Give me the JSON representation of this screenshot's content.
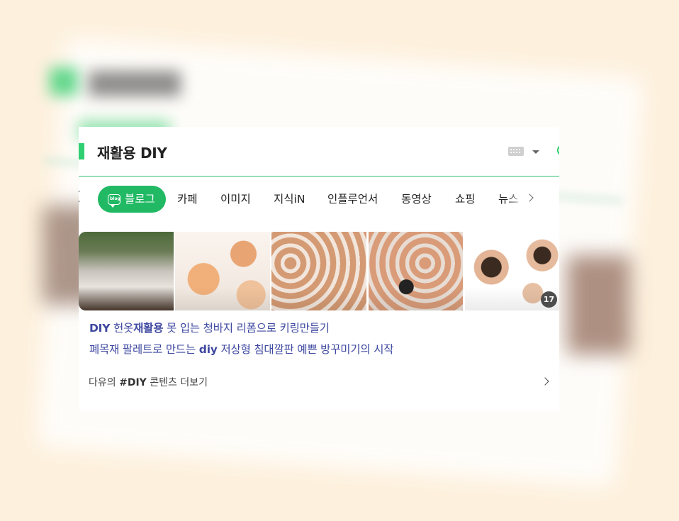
{
  "search": {
    "query": "재활용 DIY"
  },
  "tabs": [
    {
      "label": "블로그",
      "active": true,
      "icon": "blog-icon"
    },
    {
      "label": "카페"
    },
    {
      "label": "이미지"
    },
    {
      "label": "지식iN"
    },
    {
      "label": "인플루언서"
    },
    {
      "label": "동영상"
    },
    {
      "label": "쇼핑"
    },
    {
      "label": "뉴스"
    }
  ],
  "thumbnails": {
    "count_badge": "17",
    "items": [
      "egg-carton-seedlings",
      "cracked-egg-shells",
      "egg-carton-seed-packets",
      "egg-carton-soil",
      "eggshell-pots"
    ]
  },
  "links": [
    {
      "pre": "DIY",
      "mid1": " 헌옷",
      "bold2": "재활용",
      "rest": " 못 입는 청바지 리폼으로 키링만들기"
    },
    {
      "pre": "폐목재 팔레트로 만드는 ",
      "bold": "diy",
      "rest": " 저상형 침대깔판 예쁜 방꾸미기의 시작"
    }
  ],
  "more": {
    "pre": "다유의 ",
    "tag": "#DIY",
    "post": " 콘텐츠 더보기"
  },
  "colors": {
    "accent": "#21b964",
    "link": "#3e48a0",
    "background": "#fdf0dc"
  }
}
